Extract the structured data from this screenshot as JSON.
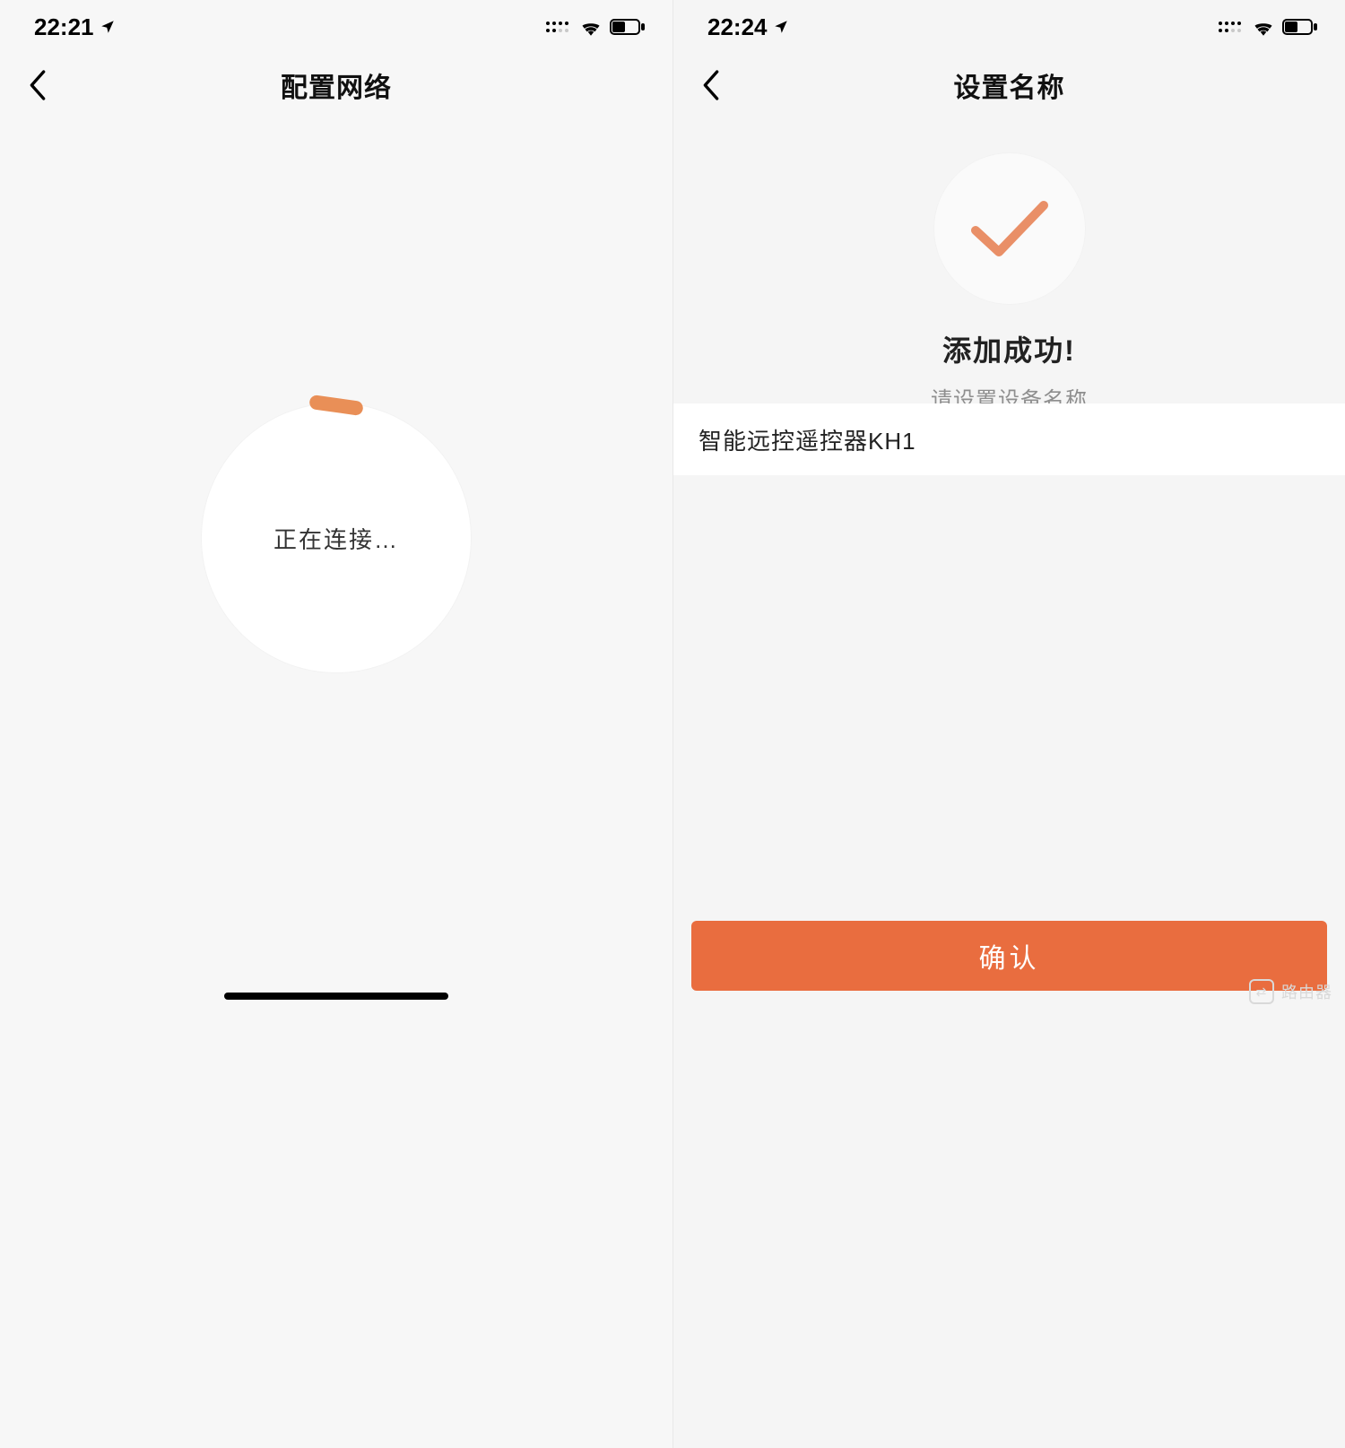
{
  "accent": "#e96d3f",
  "left": {
    "status": {
      "time": "22:21"
    },
    "nav": {
      "title": "配置网络"
    },
    "connecting": {
      "text": "正在连接…"
    }
  },
  "right": {
    "status": {
      "time": "22:24"
    },
    "nav": {
      "title": "设置名称"
    },
    "success": {
      "title": "添加成功!",
      "subtitle": "请设置设备名称"
    },
    "device_name_value": "智能远控遥控器KH1",
    "confirm_label": "确认"
  },
  "watermark": {
    "text": "路由器"
  }
}
